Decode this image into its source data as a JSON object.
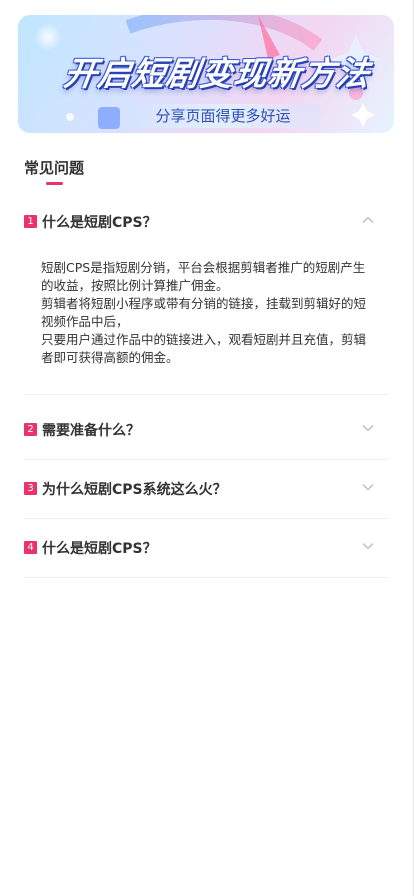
{
  "banner": {
    "title": "开启短剧变现新方法",
    "subtitle": "分享页面得更多好运"
  },
  "section": {
    "title": "常见问题"
  },
  "faq": [
    {
      "num": "1",
      "question": "什么是短剧CPS？",
      "expanded": true,
      "answer": "短剧CPS是指短剧分销，平台会根据剪辑者推广的短剧产生的收益，按照比例计算推广佣金。\n剪辑者将短剧小程序或带有分销的链接，挂载到剪辑好的短视频作品中后，\n只要用户通过作品中的链接进入，观看短剧并且充值，剪辑者即可获得高额的佣金。"
    },
    {
      "num": "2",
      "question": "需要准备什么？",
      "expanded": false
    },
    {
      "num": "3",
      "question": "为什么短剧CPS系统这么火？",
      "expanded": false
    },
    {
      "num": "4",
      "question": "什么是短剧CPS？",
      "expanded": false
    }
  ],
  "colors": {
    "accent": "#e8336d",
    "text": "#333333",
    "chevron": "#bbbbbb",
    "divider": "#eeeeee"
  },
  "icons": {
    "chevron_up": "chevron-up-icon",
    "chevron_down": "chevron-down-icon"
  }
}
